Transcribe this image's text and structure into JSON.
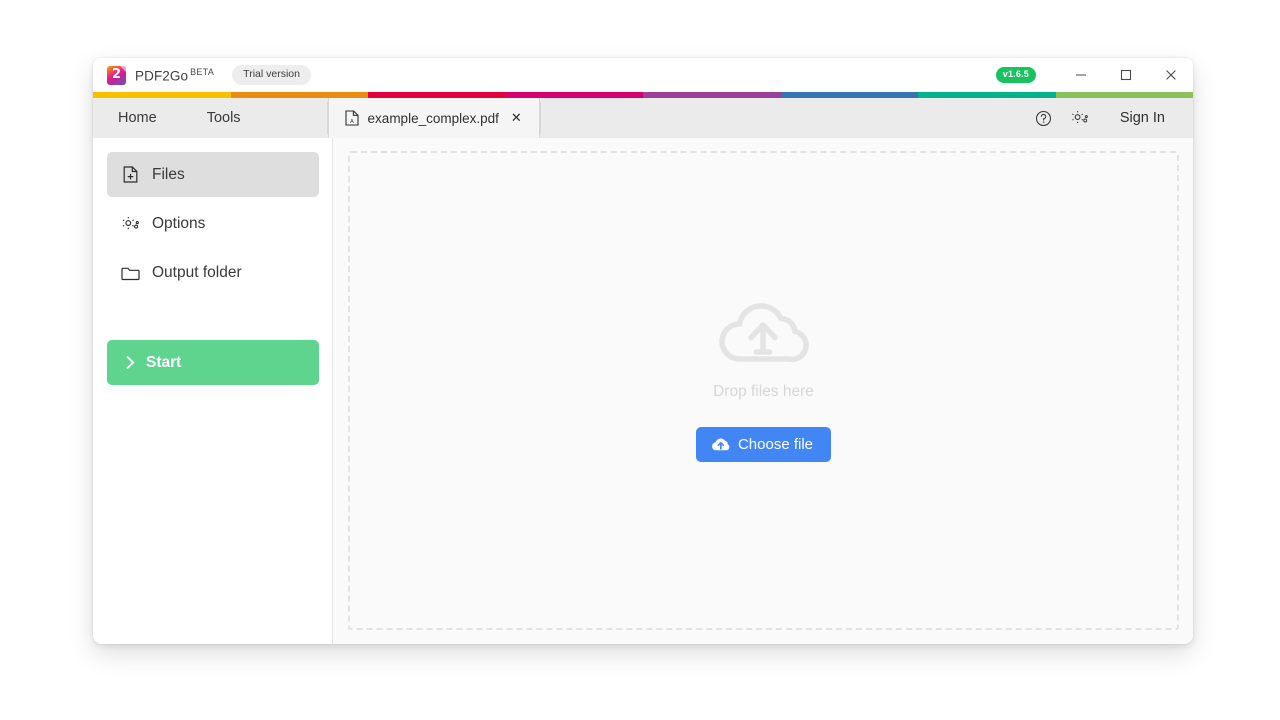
{
  "window": {
    "title_bar": {
      "logo_icon": "pdf2go-logo-icon",
      "logo_number": "2",
      "brand_name": "PDF2Go",
      "brand_suffix": "BETA",
      "trial_badge": "Trial version",
      "version_badge": "v1.6.5",
      "minimize_icon": "minimize-icon",
      "maximize_icon": "maximize-icon",
      "close_icon": "close-icon"
    },
    "accent_stripe": [
      {
        "color": "#f9c000",
        "width": 9.0
      },
      {
        "color": "#ea8c0f",
        "width": 9.0
      },
      {
        "color": "#e4003c",
        "width": 9.0
      },
      {
        "color": "#d6006e",
        "width": 9.0
      },
      {
        "color": "#9c3f99",
        "width": 9.0
      },
      {
        "color": "#3474b4",
        "width": 9.0
      },
      {
        "color": "#00b38a",
        "width": 9.0
      },
      {
        "color": "#8cc05a",
        "width": 9.0
      }
    ],
    "nav_bar": {
      "items": [
        {
          "label": "Home",
          "name": "nav-item-home"
        },
        {
          "label": "Tools",
          "name": "nav-item-tools"
        }
      ],
      "file_tab": {
        "file_icon": "pdf-file-icon",
        "label": "example_complex.pdf",
        "close_icon": "close-icon",
        "close_glyph": "✕"
      },
      "help_icon": "help-circle-icon",
      "settings_icon": "gear-icon",
      "sign_in_label": "Sign In"
    },
    "sidebar": {
      "items": [
        {
          "label": "Files",
          "icon": "file-plus-icon",
          "active": true
        },
        {
          "label": "Options",
          "icon": "gear-icon",
          "active": false
        },
        {
          "label": "Output folder",
          "icon": "folder-icon",
          "active": false
        }
      ],
      "start_button": {
        "label": "Start",
        "icon": "chevron-right-icon",
        "color": "#5fd48f"
      }
    },
    "content": {
      "dropzone": {
        "cloud_icon": "cloud-upload-icon",
        "hint_text": "Drop files here",
        "choose_button": {
          "label": "Choose file",
          "icon": "cloud-upload-icon",
          "color": "#4285f4"
        }
      }
    }
  },
  "colors": {
    "accent_blue": "#4285f4",
    "accent_green": "#5fd48f",
    "version_green": "#18c35f",
    "nav_background": "#ebebeb",
    "content_background": "#fafafa",
    "sidebar_active": "#dedede",
    "dropzone_border": "#e2e2e2"
  }
}
